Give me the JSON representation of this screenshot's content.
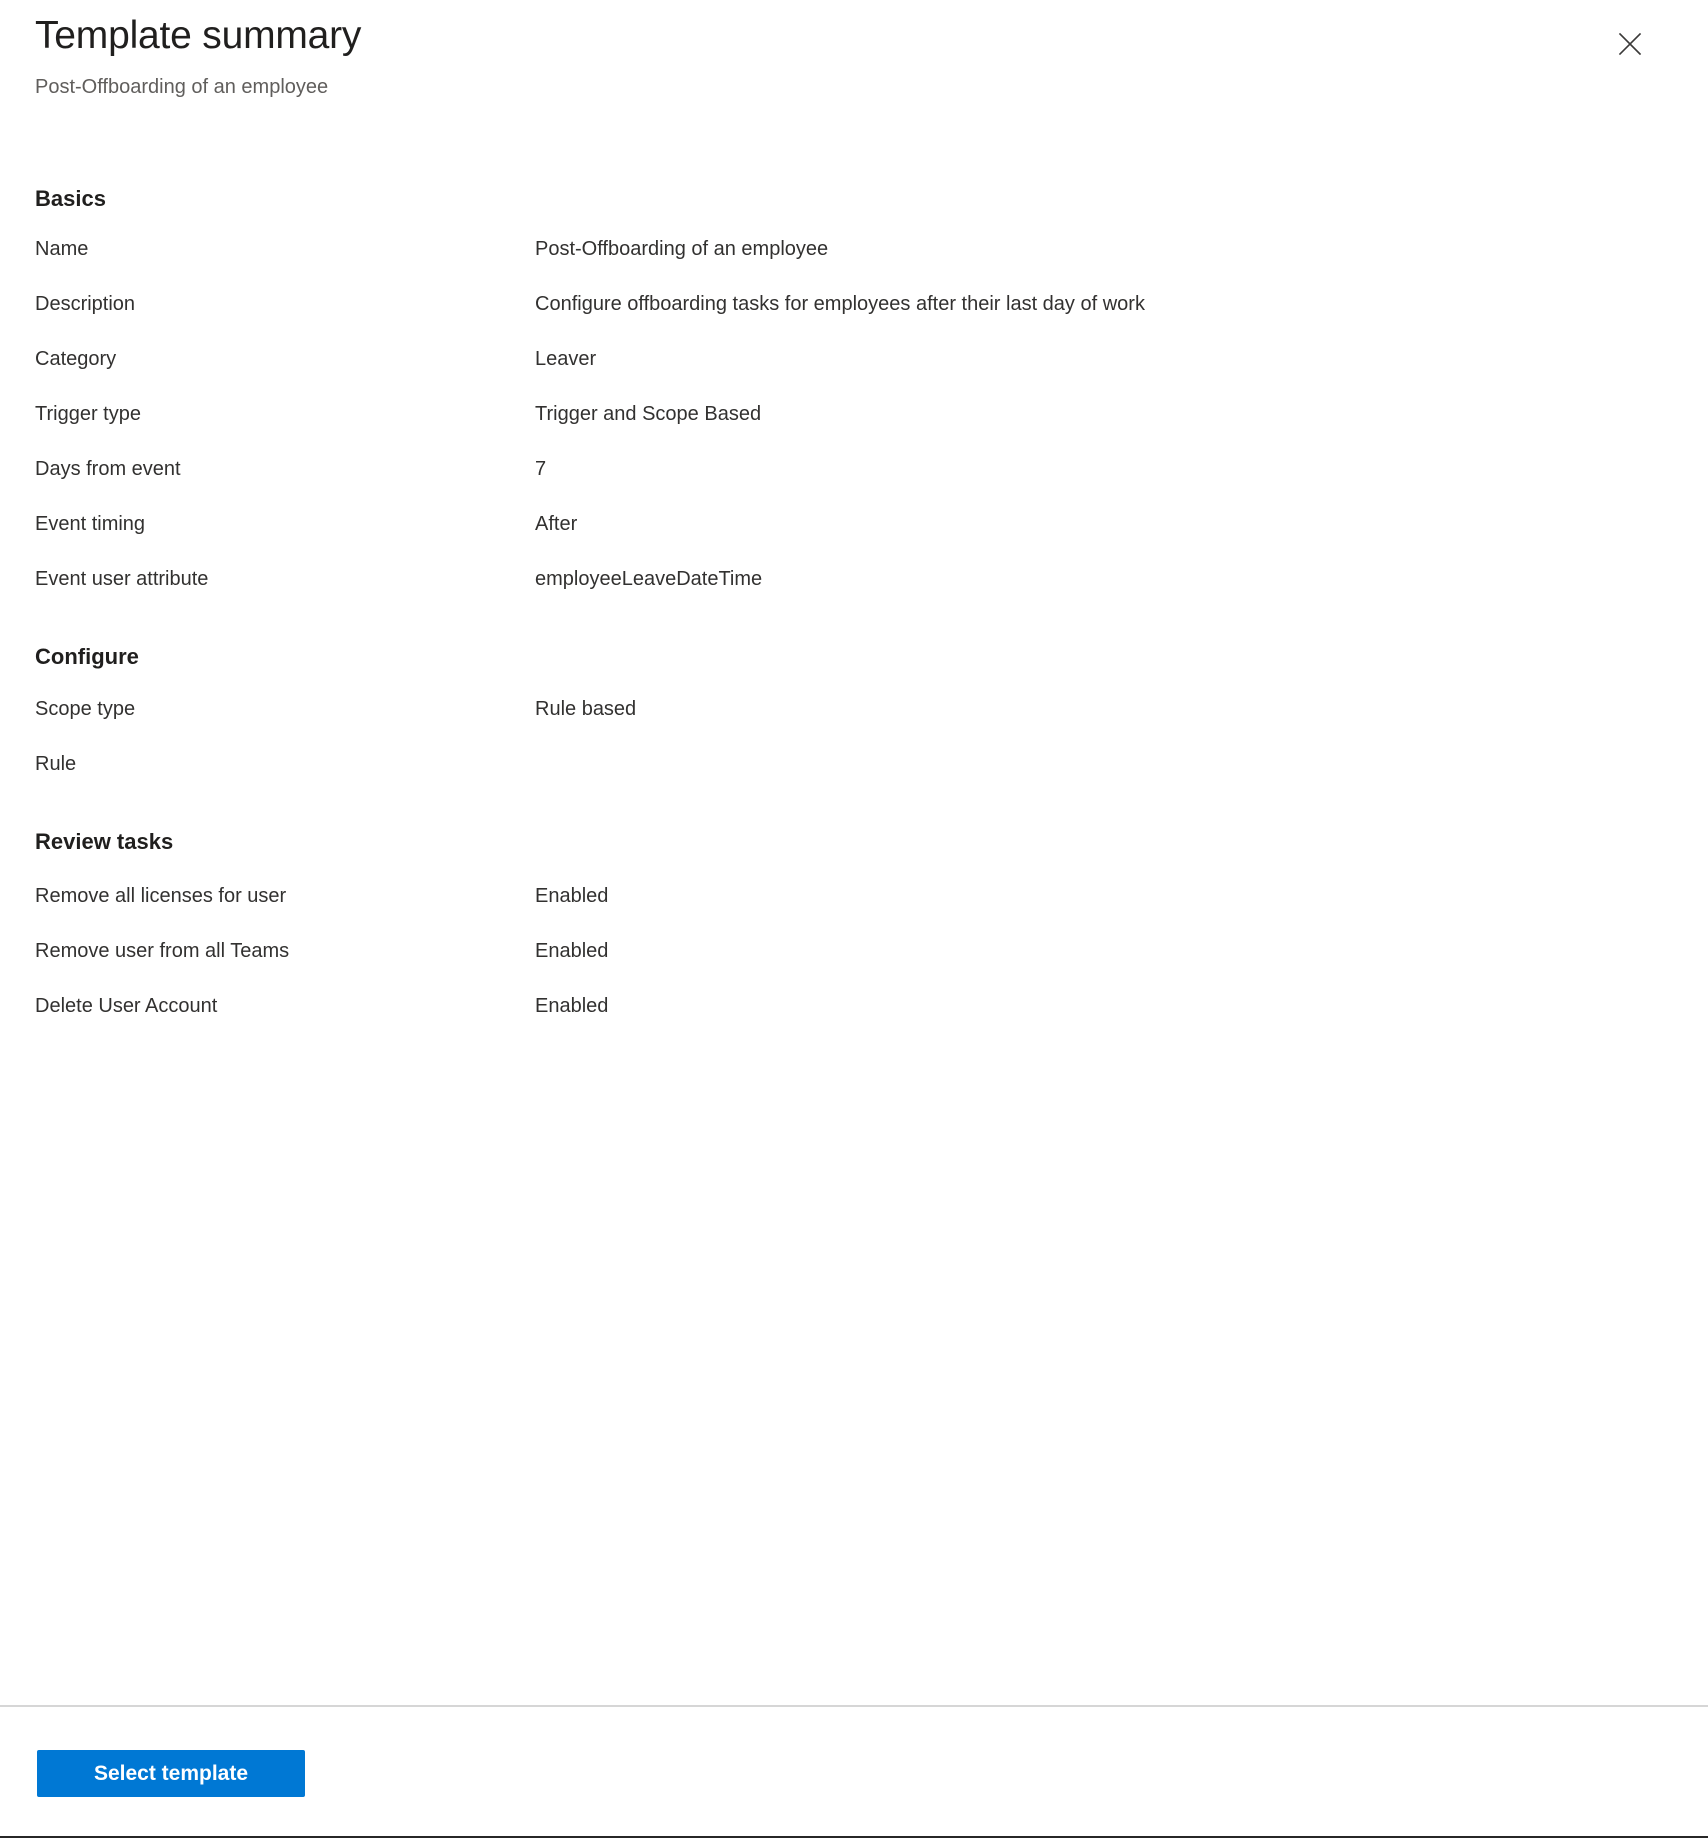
{
  "header": {
    "title": "Template summary",
    "subtitle": "Post-Offboarding of an employee",
    "close_icon": "close-icon",
    "close_label": "Close"
  },
  "sections": [
    {
      "heading": "Basics",
      "rows": [
        {
          "label": "Name",
          "value": "Post-Offboarding of an employee"
        },
        {
          "label": "Description",
          "value": "Configure offboarding tasks for employees after their last day of work"
        },
        {
          "label": "Category",
          "value": "Leaver"
        },
        {
          "label": "Trigger type",
          "value": "Trigger and Scope Based"
        },
        {
          "label": "Days from event",
          "value": "7"
        },
        {
          "label": "Event timing",
          "value": "After"
        },
        {
          "label": "Event user attribute",
          "value": "employeeLeaveDateTime"
        }
      ]
    },
    {
      "heading": "Configure",
      "rows": [
        {
          "label": "Scope type",
          "value": "Rule based"
        },
        {
          "label": "Rule",
          "value": ""
        }
      ]
    },
    {
      "heading": "Review tasks",
      "rows": [
        {
          "label": "Remove all licenses for user",
          "value": "Enabled"
        },
        {
          "label": "Remove user from all Teams",
          "value": "Enabled"
        },
        {
          "label": "Delete User Account",
          "value": "Enabled"
        }
      ]
    }
  ],
  "footer": {
    "select_template_label": "Select template"
  },
  "colors": {
    "accent": "#0078d4",
    "text_primary": "#201f1e",
    "text_body": "#323130",
    "text_secondary": "#605e5c",
    "divider": "#d6d6d6",
    "background": "#ffffff"
  }
}
